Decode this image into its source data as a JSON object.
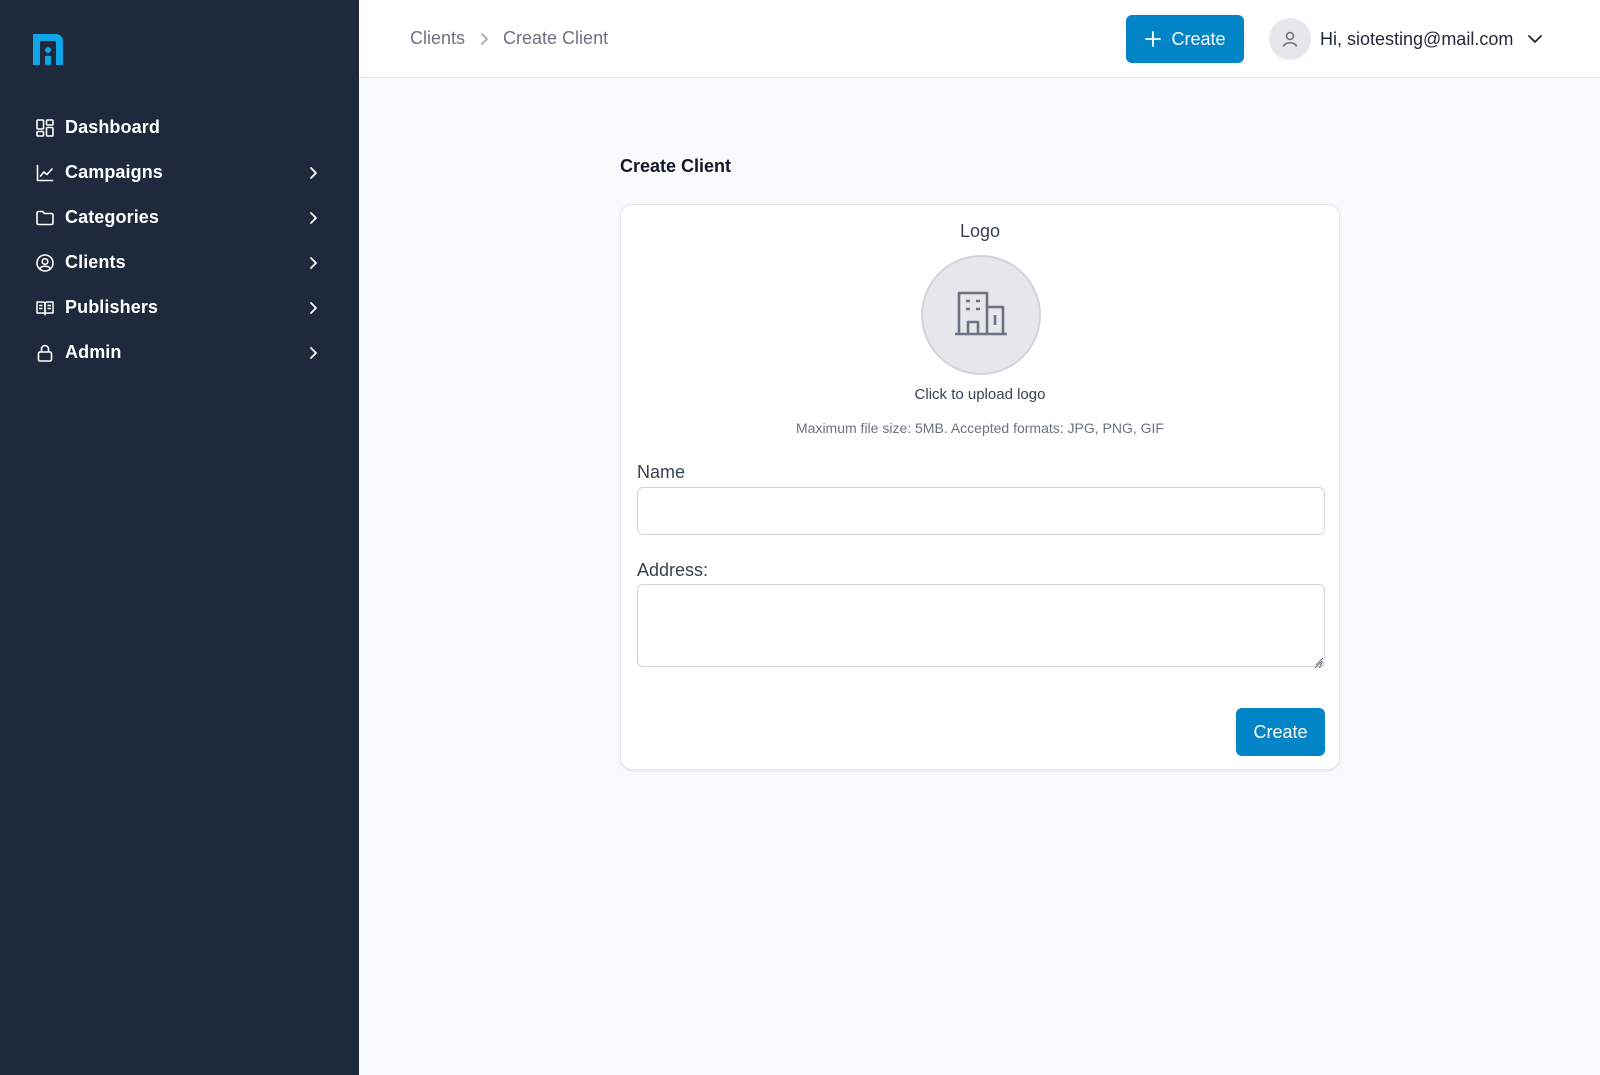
{
  "app": {
    "logo_icon": "brand-logo-icon",
    "accent_color": "#0284c7",
    "sidebar_color": "#1e293b"
  },
  "sidebar": {
    "items": [
      {
        "label": "Dashboard",
        "icon": "dashboard-icon",
        "has_chevron": false
      },
      {
        "label": "Campaigns",
        "icon": "chart-line-icon",
        "has_chevron": true
      },
      {
        "label": "Categories",
        "icon": "folder-icon",
        "has_chevron": true
      },
      {
        "label": "Clients",
        "icon": "user-circle-icon",
        "has_chevron": true
      },
      {
        "label": "Publishers",
        "icon": "book-open-icon",
        "has_chevron": true
      },
      {
        "label": "Admin",
        "icon": "lock-icon",
        "has_chevron": true
      }
    ]
  },
  "header": {
    "breadcrumb": [
      "Clients",
      "Create Client"
    ],
    "create_label": "Create",
    "user_greeting": "Hi, siotesting@mail.com"
  },
  "form": {
    "title": "Create Client",
    "logo_heading": "Logo",
    "upload_text": "Click to upload logo",
    "upload_hint": "Maximum file size: 5MB. Accepted formats: JPG, PNG, GIF",
    "name_label": "Name",
    "name_value": "",
    "address_label": "Address:",
    "address_value": "",
    "submit_label": "Create"
  }
}
